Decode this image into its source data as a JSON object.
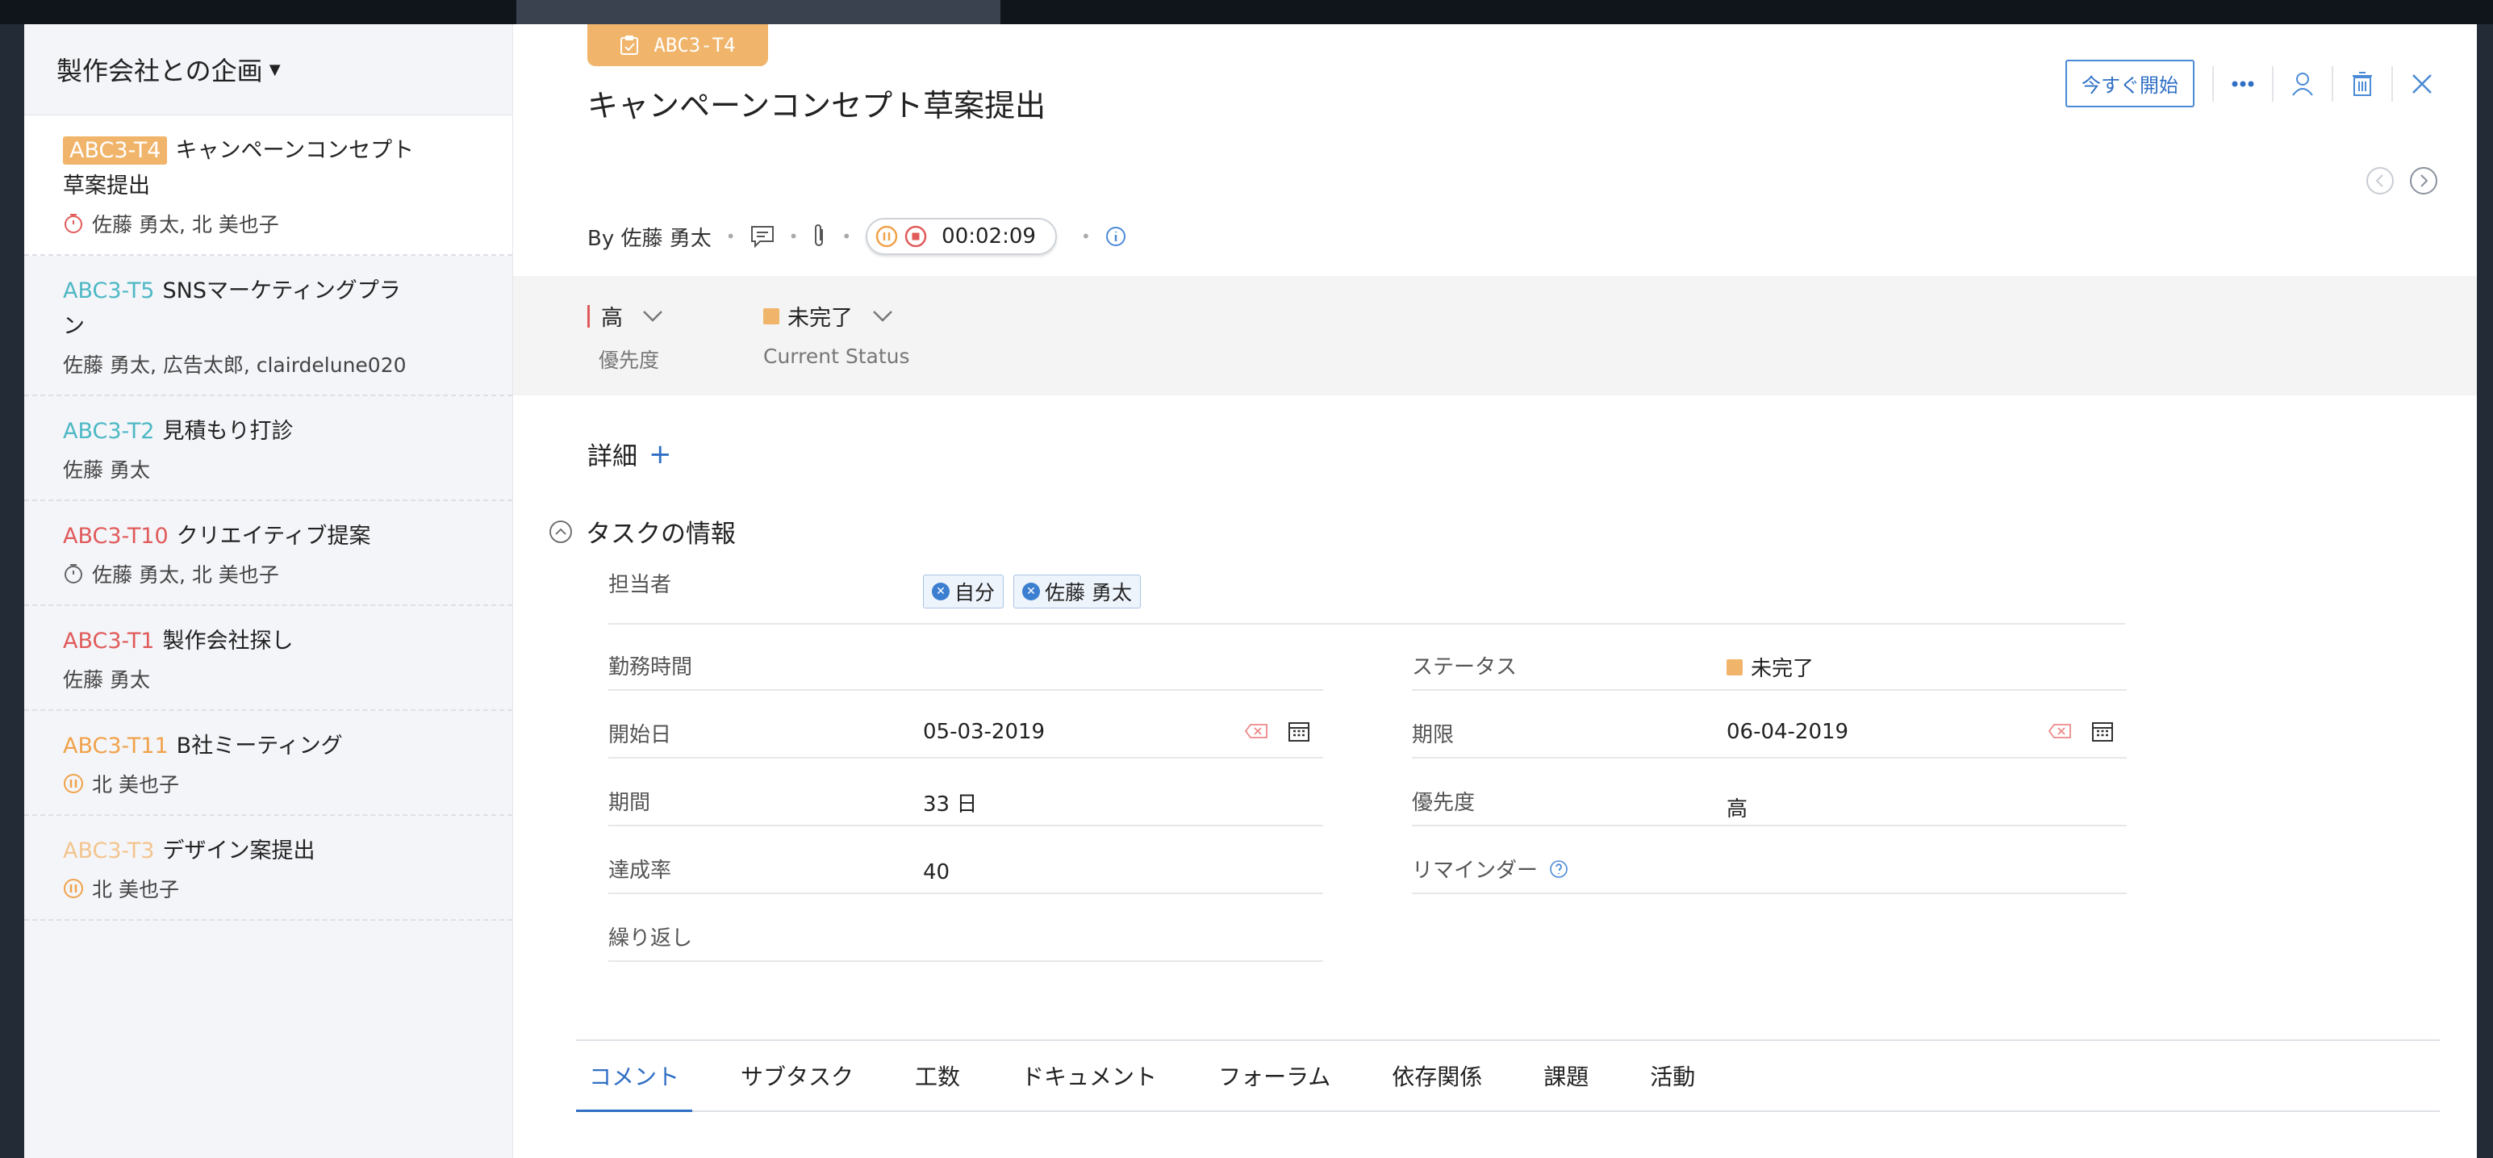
{
  "project": {
    "name": "製作会社との企画"
  },
  "tasks": [
    {
      "id": "ABC3-T4",
      "title": "キャンペーンコンセプト草案提出",
      "owners": "佐藤 勇太, 北 美也子",
      "id_color": "#ffffff",
      "icon": "timer-red-icon"
    },
    {
      "id": "ABC3-T5",
      "title": "SNSマーケティングプラン",
      "owners": "佐藤 勇太, 広告太郎, clairdelune020",
      "id_color": "#4cb8c4",
      "icon": ""
    },
    {
      "id": "ABC3-T2",
      "title": "見積もり打診",
      "owners": "佐藤 勇太",
      "id_color": "#4cb8c4",
      "icon": ""
    },
    {
      "id": "ABC3-T10",
      "title": "クリエイティブ提案",
      "owners": "佐藤 勇太, 北 美也子",
      "id_color": "#e05a5a",
      "icon": "timer-gray-icon"
    },
    {
      "id": "ABC3-T1",
      "title": "製作会社探し",
      "owners": "佐藤 勇太",
      "id_color": "#e05a5a",
      "icon": ""
    },
    {
      "id": "ABC3-T11",
      "title": "B社ミーティング",
      "owners": "北 美也子",
      "id_color": "#f0a24a",
      "icon": "pause-orange-icon"
    },
    {
      "id": "ABC3-T3",
      "title": "デザイン案提出",
      "owners": "北 美也子",
      "id_color": "#f3c48e",
      "icon": "pause-orange-icon"
    }
  ],
  "detail": {
    "id": "ABC3-T4",
    "title": "キャンペーンコンセプト草案提出",
    "by": "By 佐藤 勇太",
    "timer": "00:02:09",
    "start_label": "今すぐ開始",
    "priority_value": "高",
    "priority_label": "優先度",
    "status_value": "未完了",
    "status_label": "Current Status",
    "details_label": "詳細",
    "details_plus": "+",
    "task_info_label": "タスクの情報"
  },
  "fields": {
    "assignee_label": "担当者",
    "assignees": [
      "自分",
      "佐藤 勇太"
    ],
    "work_hours_label": "勤務時間",
    "status_label": "ステータス",
    "status_value": "未完了",
    "start_label": "開始日",
    "start_value": "05-03-2019",
    "due_label": "期限",
    "due_value": "06-04-2019",
    "period_label": "期間",
    "period_value": "33 日",
    "priority_label": "優先度",
    "priority_value": "高",
    "progress_label": "達成率",
    "progress_value": "40",
    "reminder_label": "リマインダー",
    "repeat_label": "繰り返し"
  },
  "tabs": [
    "コメント",
    "サブタスク",
    "工数",
    "ドキュメント",
    "フォーラム",
    "依存関係",
    "課題",
    "活動"
  ],
  "colors": {
    "accent": "#2f6fc4",
    "badge": "#f0b46a",
    "priority_high": "#e05a5a"
  }
}
